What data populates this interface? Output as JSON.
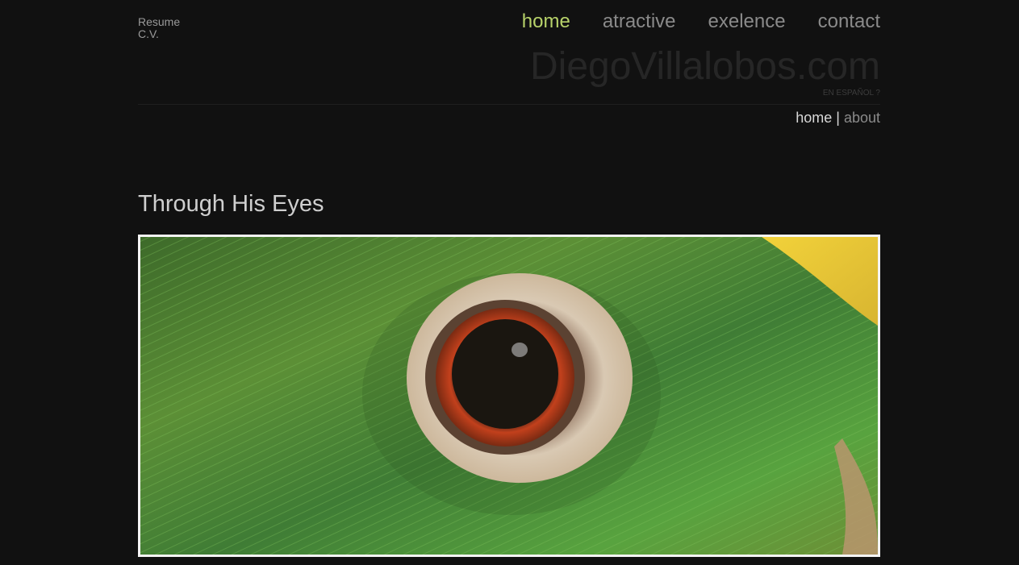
{
  "side_links": {
    "resume": "Resume",
    "cv": "C.V."
  },
  "main_nav": {
    "items": [
      {
        "label": "home",
        "active": true
      },
      {
        "label": "atractive",
        "active": false
      },
      {
        "label": "exelence",
        "active": false
      },
      {
        "label": "contact",
        "active": false
      }
    ]
  },
  "header": {
    "site_title": "DiegoVillalobos.com",
    "language_link": "EN ESPAÑOL ?"
  },
  "sub_nav": {
    "current": "home",
    "separator": "|",
    "other": "about"
  },
  "post": {
    "title": "Through His Eyes"
  },
  "colors": {
    "background": "#111111",
    "active_nav": "#b7d26a",
    "nav": "#8a8a8a",
    "title_text": "#cfcfcf"
  }
}
